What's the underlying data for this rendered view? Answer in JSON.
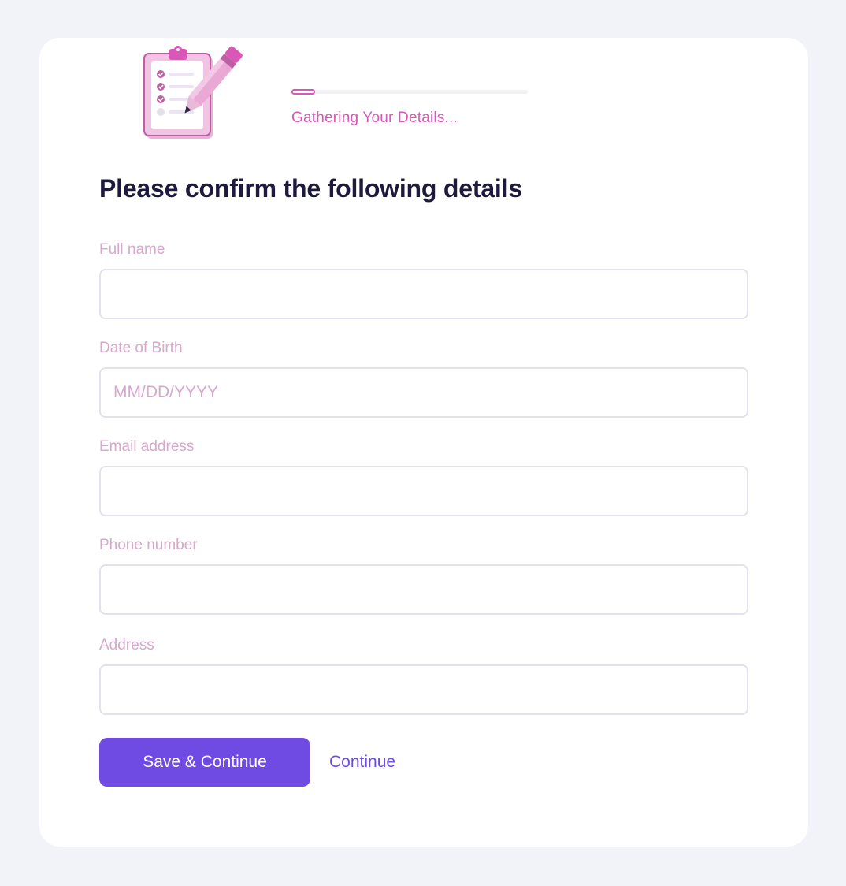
{
  "progress": {
    "label": "Gathering Your Details...",
    "fraction": 0.1
  },
  "form": {
    "heading": "Please confirm the following details",
    "fields": [
      {
        "label": "Full name",
        "value": "",
        "placeholder": ""
      },
      {
        "label": "Date of Birth",
        "value": "",
        "placeholder": "MM/DD/YYYY"
      },
      {
        "label": "Email address",
        "value": "",
        "placeholder": ""
      },
      {
        "label": "Phone number",
        "value": "",
        "placeholder": ""
      },
      {
        "label": "Address",
        "value": "",
        "placeholder": ""
      }
    ]
  },
  "actions": {
    "primary_label": "Save & Continue",
    "secondary_label": "Continue"
  },
  "illustration": {
    "icon": "clipboard-checklist-pencil-icon"
  },
  "colors": {
    "accent": "#6f4ae3",
    "pink": "#d957b7",
    "label": "#d6a8cd",
    "heading": "#1e1a3e"
  }
}
